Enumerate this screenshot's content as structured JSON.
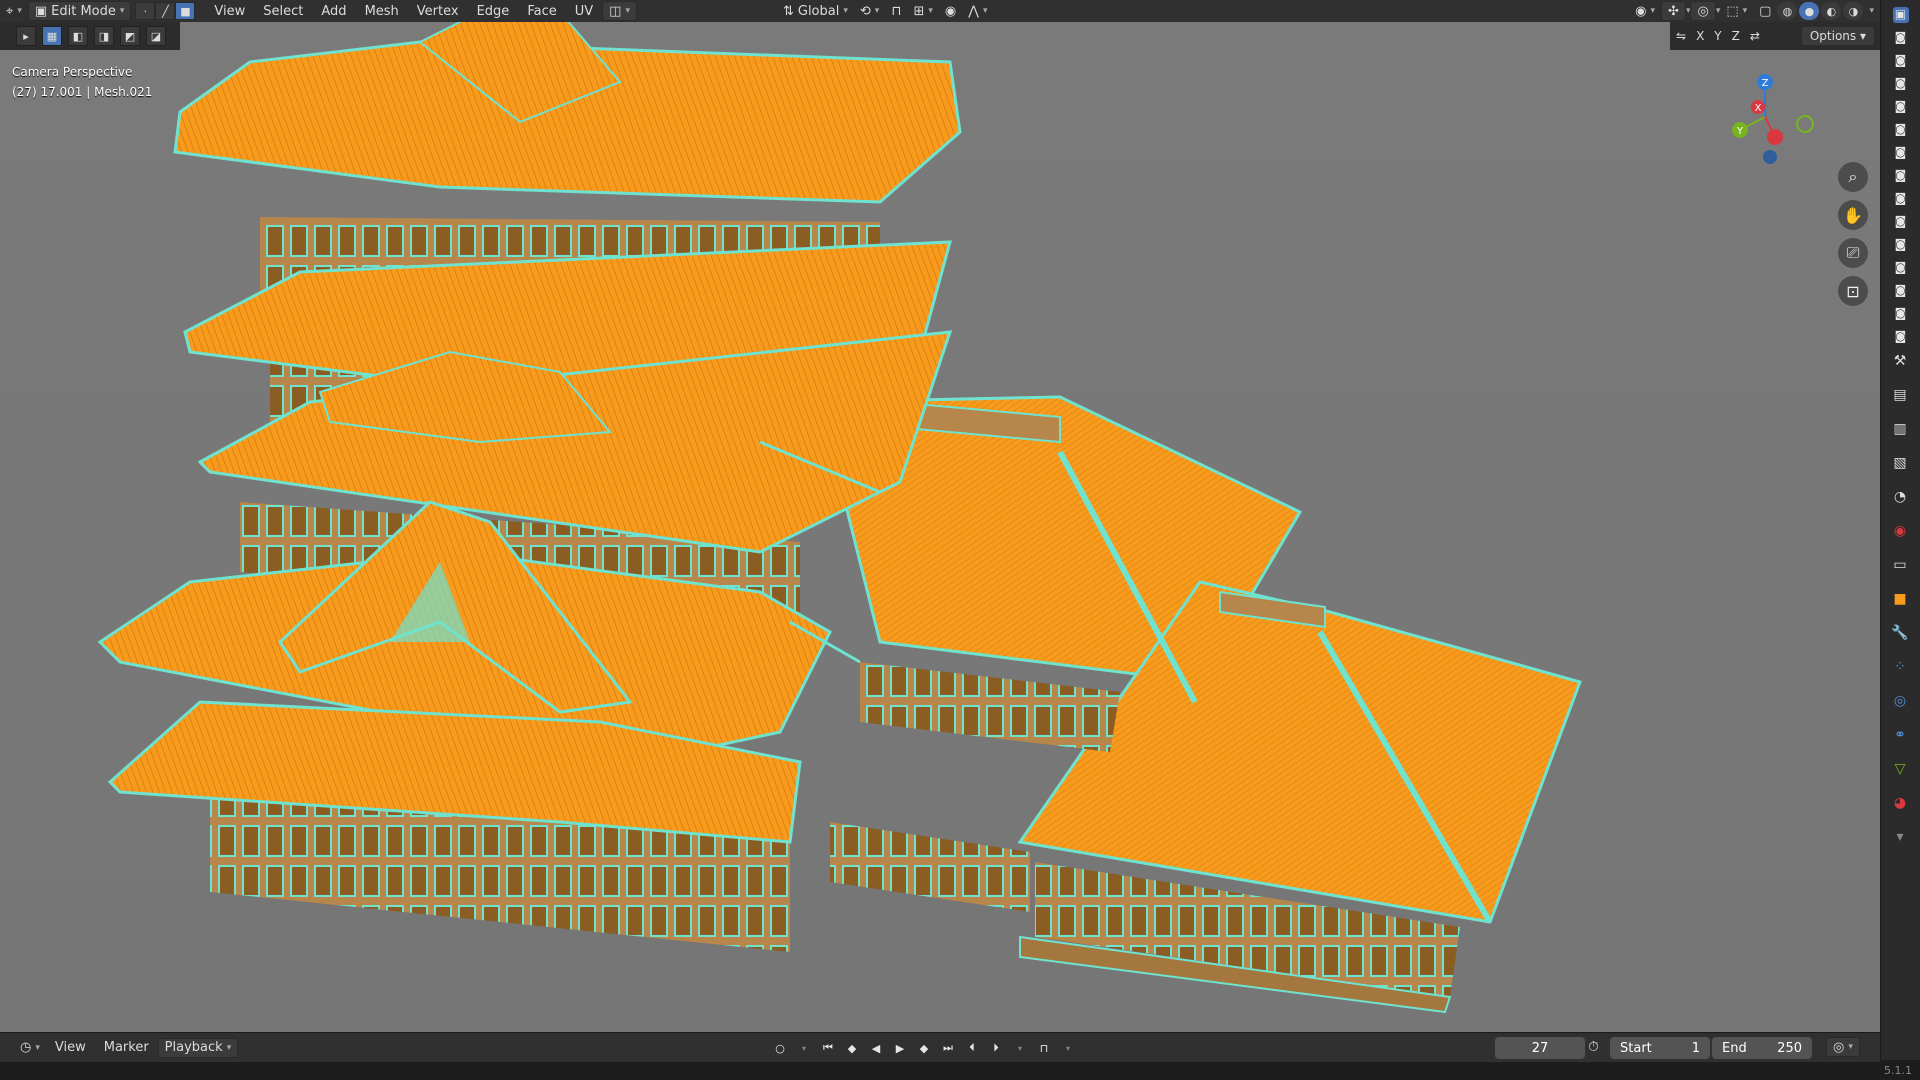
{
  "header": {
    "editor_icon": "editor-type-icon",
    "mode": "Edit Mode",
    "menus": [
      "View",
      "Select",
      "Add",
      "Mesh",
      "Vertex",
      "Edge",
      "Face",
      "UV"
    ],
    "transform_orientation": "Global"
  },
  "viewport": {
    "view_name": "Camera Perspective",
    "object_info": "(27) 17.001 | Mesh.021",
    "axes": [
      "X",
      "Y",
      "Z"
    ],
    "options_label": "Options",
    "gizmo_axes": {
      "z": "Z",
      "x": "X",
      "y": "Y"
    },
    "nav_tools": [
      "zoom-icon",
      "hand-icon",
      "camera-icon",
      "lock-icon"
    ]
  },
  "timeline": {
    "menus": [
      "View",
      "Marker",
      "Playback"
    ],
    "current_frame": "27",
    "start_label": "Start",
    "start_value": "1",
    "end_label": "End",
    "end_value": "250"
  },
  "status": {
    "version": "5.1.1"
  },
  "colors": {
    "selected_face": "#f89a1c",
    "edge_highlight": "#6fe3cf",
    "active_blue": "#4772b3",
    "gizmo_x": "#d9383f",
    "gizmo_y": "#79b31f",
    "gizmo_z": "#2e7bd9"
  }
}
